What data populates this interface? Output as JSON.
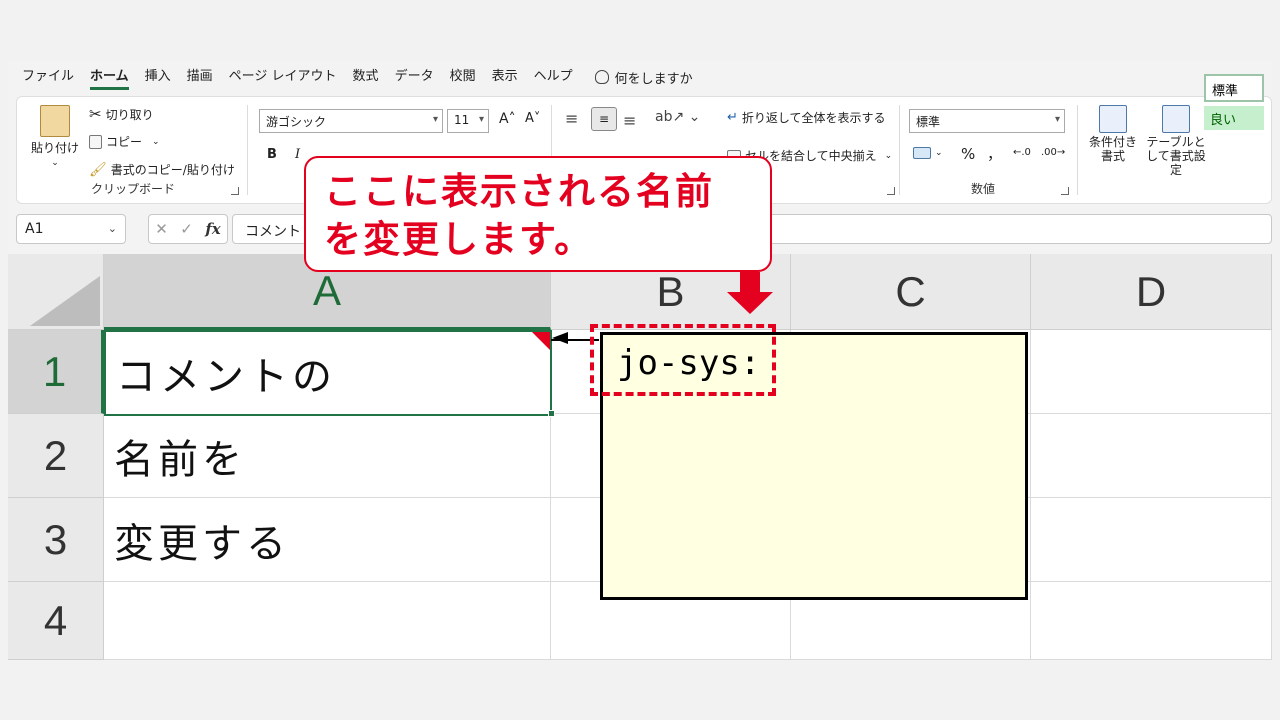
{
  "tabs": [
    "ファイル",
    "ホーム",
    "挿入",
    "描画",
    "ページ レイアウト",
    "数式",
    "データ",
    "校閲",
    "表示",
    "ヘルプ"
  ],
  "active_tab_index": 1,
  "tell_me": "何をしますか",
  "ribbon": {
    "clipboard": {
      "paste": "貼り付け",
      "cut": "切り取り",
      "copy": "コピー",
      "format_painter": "書式のコピー/貼り付け",
      "label": "クリップボード"
    },
    "font": {
      "name": "游ゴシック",
      "size": "11",
      "bold": "B",
      "italic": "I"
    },
    "alignment": {
      "wrap_text": "折り返して全体を表示する",
      "merge_center": "セルを結合して中央揃え"
    },
    "number": {
      "format": "標準",
      "percent": "%",
      "comma": "，",
      "label": "数値"
    },
    "styles": {
      "conditional": "条件付き書式",
      "table": "テーブルとして書式設定",
      "normal": "標準",
      "good": "良い"
    }
  },
  "formula_bar": {
    "name_box": "A1",
    "cancel": "✕",
    "enter": "✓",
    "fx": "fx",
    "content": "コメント"
  },
  "grid": {
    "columns": [
      "A",
      "B",
      "C",
      "D"
    ],
    "rows": [
      "1",
      "2",
      "3",
      "4"
    ],
    "cells": [
      "コメントの",
      "名前を",
      "変更する",
      ""
    ]
  },
  "comment": {
    "author": "jo-sys:"
  },
  "callout": {
    "line1": "ここに表示される名前",
    "line2": "を変更します。"
  },
  "colors": {
    "accent": "#217346",
    "callout": "#e4001f",
    "comment_bg": "#ffffe1"
  }
}
